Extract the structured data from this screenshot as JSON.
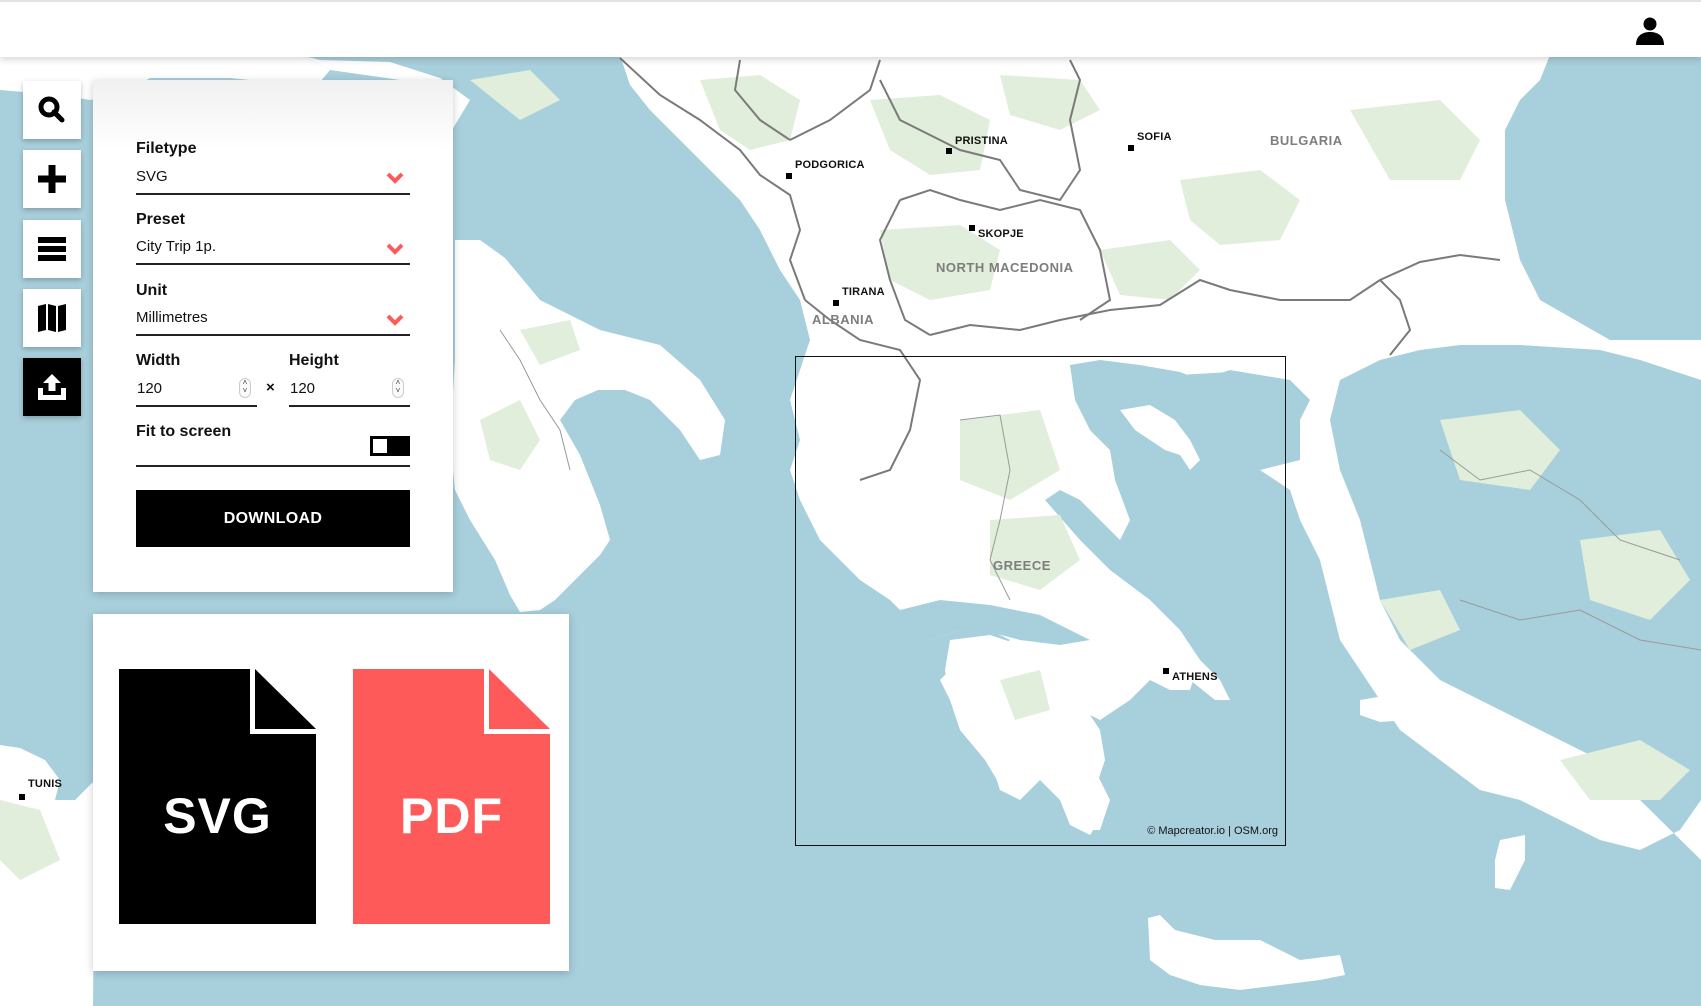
{
  "header": {
    "user_icon": "user-icon"
  },
  "toolbar": [
    {
      "name": "search",
      "icon": "search-icon",
      "active": false
    },
    {
      "name": "add",
      "icon": "plus-icon",
      "active": false
    },
    {
      "name": "layers",
      "icon": "menu-icon",
      "active": false
    },
    {
      "name": "map-styles",
      "icon": "map-icon",
      "active": false
    },
    {
      "name": "export",
      "icon": "upload-icon",
      "active": true
    }
  ],
  "export_panel": {
    "filetype": {
      "label": "Filetype",
      "value": "SVG"
    },
    "preset": {
      "label": "Preset",
      "value": "City Trip 1p."
    },
    "unit": {
      "label": "Unit",
      "value": "Millimetres"
    },
    "width": {
      "label": "Width",
      "value": "120"
    },
    "height": {
      "label": "Height",
      "value": "120"
    },
    "times_symbol": "×",
    "fit_to_screen": {
      "label": "Fit to screen",
      "enabled": false
    },
    "download_label": "DOWNLOAD"
  },
  "formats": [
    {
      "label": "SVG",
      "color": "#000000"
    },
    {
      "label": "PDF",
      "color": "#ff5a5a"
    }
  ],
  "accent_color": "#ff5a5a",
  "map": {
    "colors": {
      "sea": "#a8cfdc",
      "land": "#ffffff",
      "forest": "#e1eedb",
      "border": "#7a7a7a"
    },
    "cities": [
      {
        "name": "PODGORICA"
      },
      {
        "name": "PRISTINA"
      },
      {
        "name": "SOFIA"
      },
      {
        "name": "SKOPJE"
      },
      {
        "name": "TIRANA"
      },
      {
        "name": "ATHENS"
      },
      {
        "name": "TUNIS"
      }
    ],
    "countries": [
      {
        "name": "BULGARIA"
      },
      {
        "name": "NORTH MACEDONIA"
      },
      {
        "name": "ALBANIA"
      },
      {
        "name": "GREECE"
      }
    ],
    "attribution": "© Mapcreator.io | OSM.org"
  }
}
